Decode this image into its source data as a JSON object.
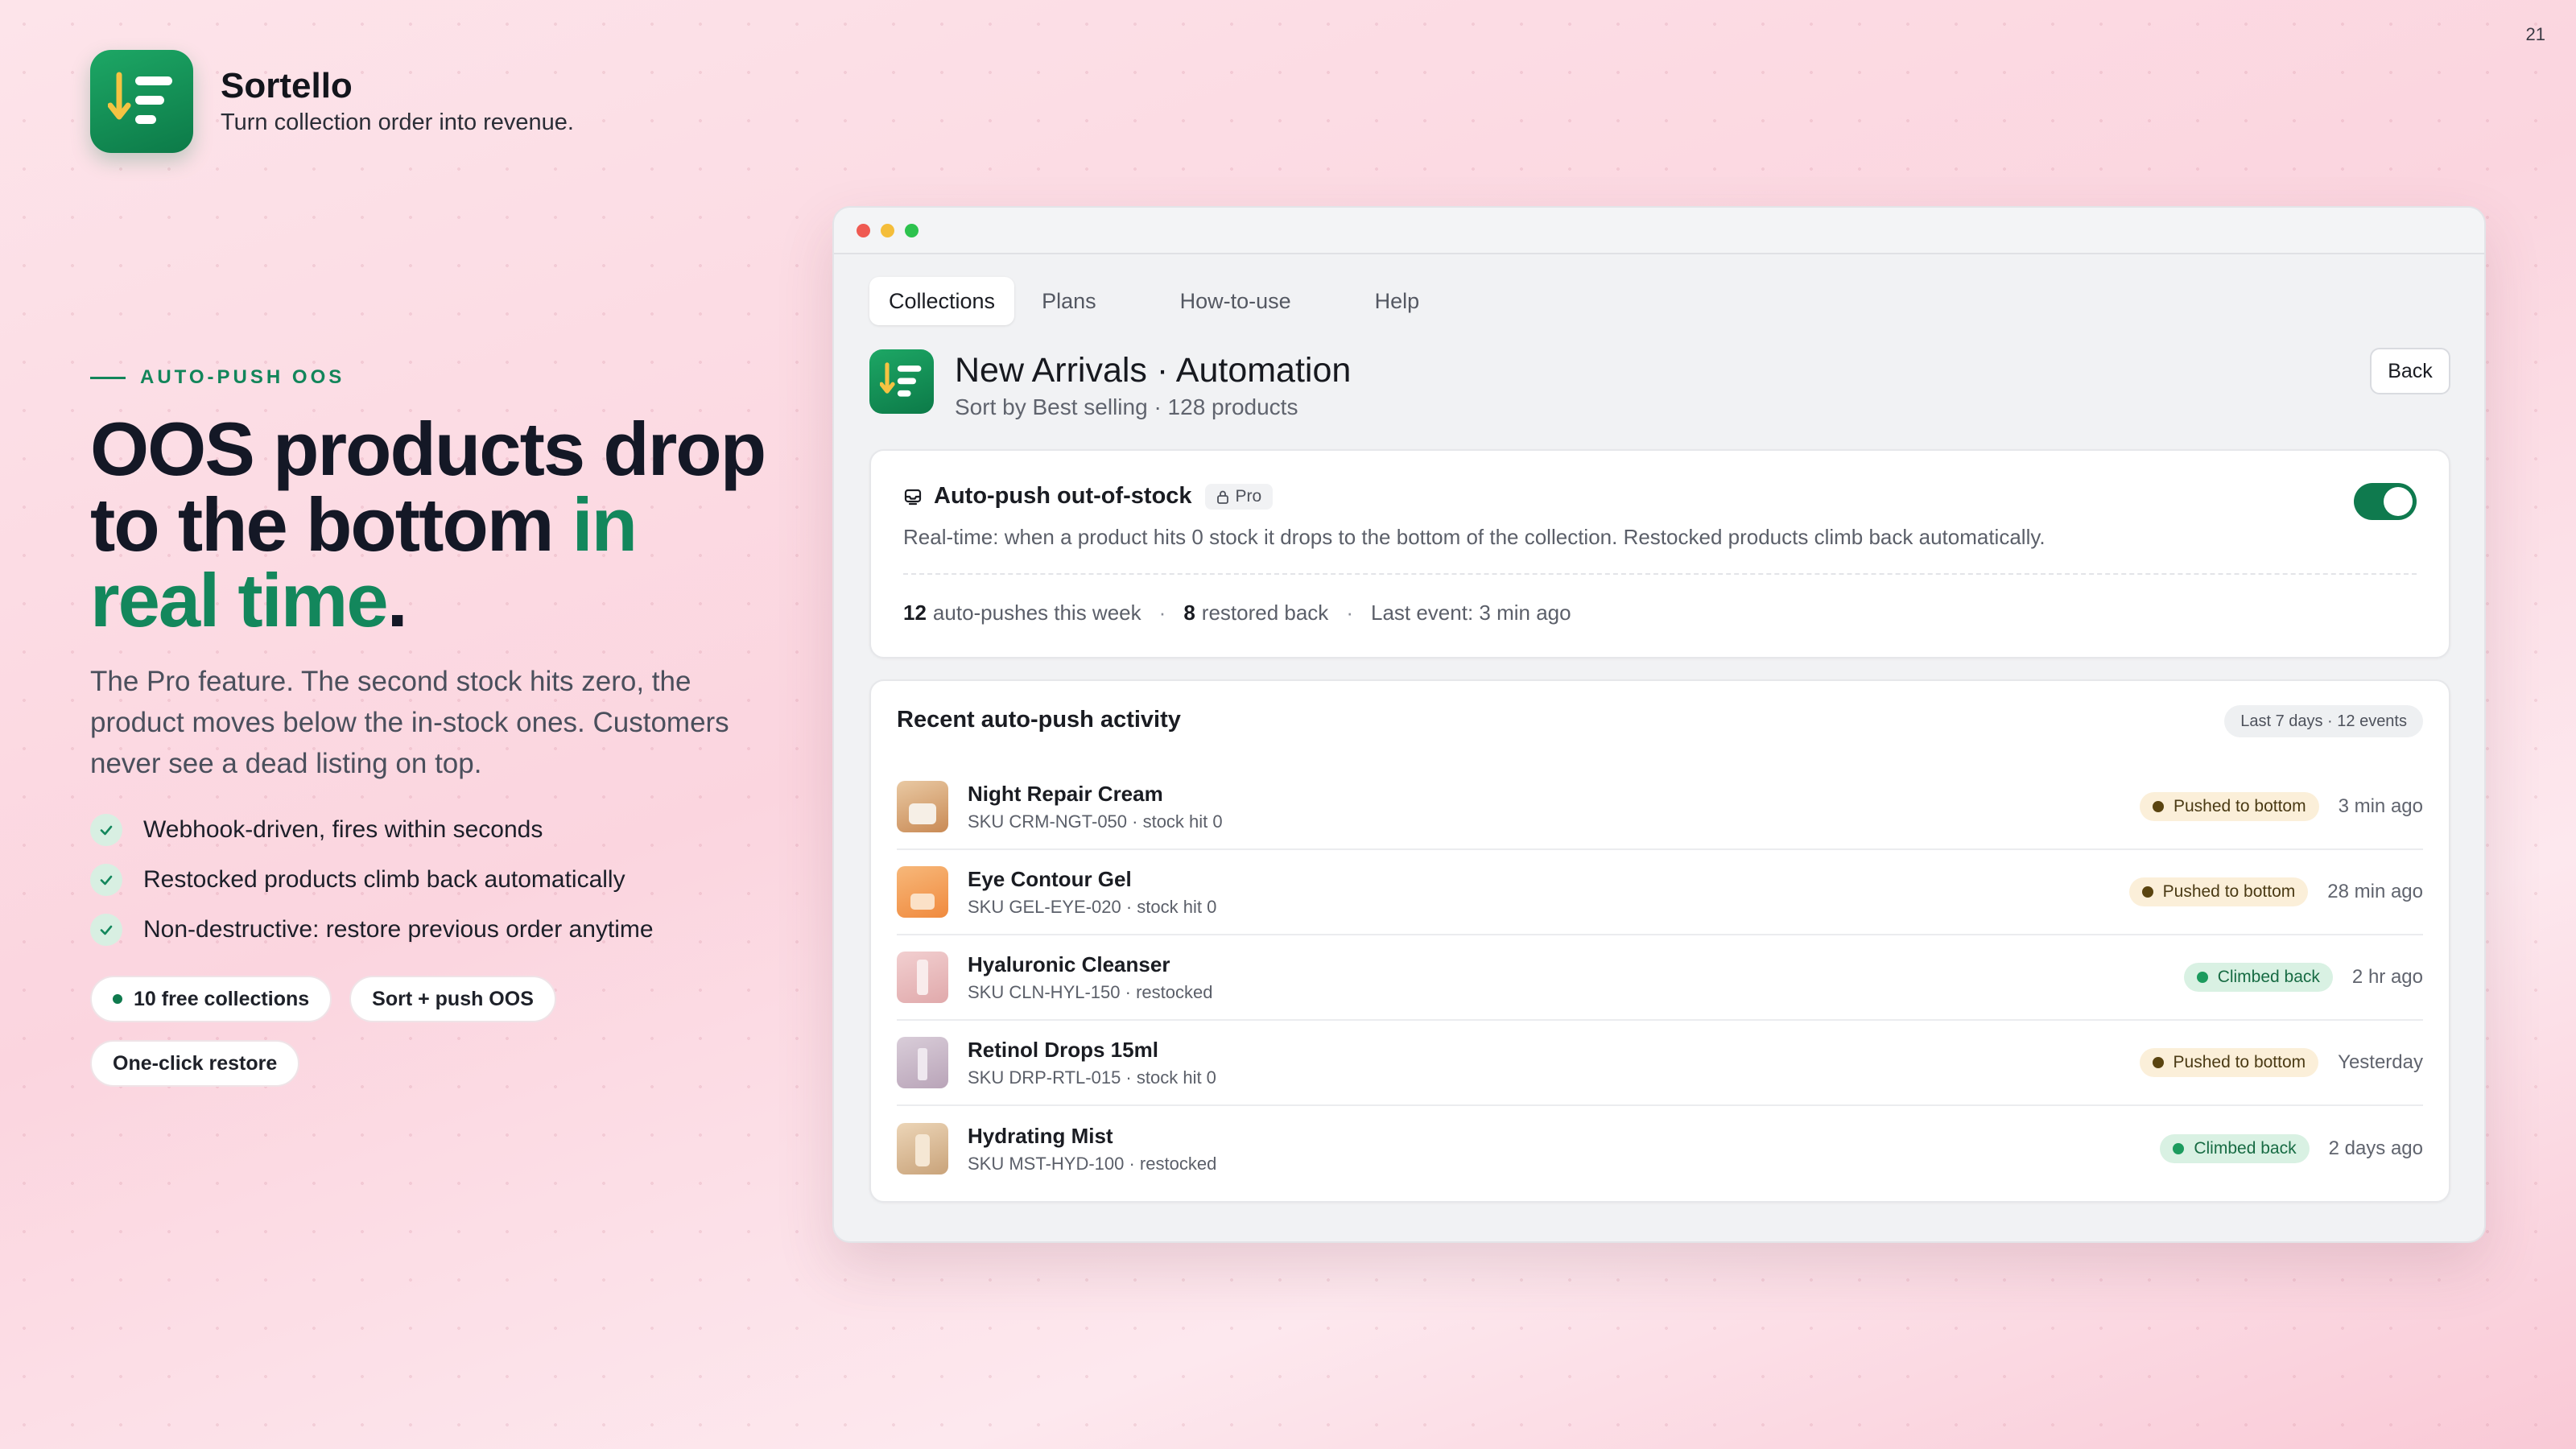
{
  "page_number": "21",
  "brand": {
    "name": "Sortello",
    "tagline": "Turn collection order into revenue."
  },
  "hero": {
    "eyebrow": "AUTO-PUSH OOS",
    "headline_part1": "OOS products drop to the bottom",
    "headline_accent": "in real time",
    "headline_end": ".",
    "lead": "The Pro feature. The second stock hits zero, the product moves below the in-stock ones. Customers never see a dead listing on top.",
    "features": [
      "Webhook-driven, fires within seconds",
      "Restocked products climb back automatically",
      "Non-destructive: restore previous order anytime"
    ],
    "pills": [
      "10 free collections",
      "Sort + push OOS",
      "One-click restore"
    ]
  },
  "app": {
    "tabs": [
      "Collections",
      "Plans",
      "How-to-use",
      "Help"
    ],
    "active_tab": "Collections",
    "page_title": "New Arrivals · Automation",
    "page_subtitle": "Sort by Best selling · 128 products",
    "back_label": "Back",
    "oos_card": {
      "title": "Auto-push out-of-stock",
      "badge": "Pro",
      "description": "Real-time: when a product hits 0 stock it drops to the bottom of the collection. Restocked products climb back automatically.",
      "toggle_on": true,
      "stat1_value": "12",
      "stat1_label": "auto-pushes this week",
      "stat2_value": "8",
      "stat2_label": "restored back",
      "stat3": "Last event: 3 min ago"
    },
    "activity": {
      "title": "Recent auto-push activity",
      "badge": "Last 7 days · 12 events",
      "rows": [
        {
          "name": "Night Repair Cream",
          "sku": "SKU CRM-NGT-050 · stock hit 0",
          "status": "Pushed to bottom",
          "status_type": "pushed",
          "time": "3 min ago"
        },
        {
          "name": "Eye Contour Gel",
          "sku": "SKU GEL-EYE-020 · stock hit 0",
          "status": "Pushed to bottom",
          "status_type": "pushed",
          "time": "28 min ago"
        },
        {
          "name": "Hyaluronic Cleanser",
          "sku": "SKU CLN-HYL-150 · restocked",
          "status": "Climbed back",
          "status_type": "climbed",
          "time": "2 hr ago"
        },
        {
          "name": "Retinol Drops 15ml",
          "sku": "SKU DRP-RTL-015 · stock hit 0",
          "status": "Pushed to bottom",
          "status_type": "pushed",
          "time": "Yesterday"
        },
        {
          "name": "Hydrating Mist",
          "sku": "SKU MST-HYD-100 · restocked",
          "status": "Climbed back",
          "status_type": "climbed",
          "time": "2 days ago"
        }
      ]
    }
  },
  "colors": {
    "brand_green": "#0f7a4e",
    "accent_text_green": "#13875c",
    "pushed_bg": "#fbefd9",
    "climbed_bg": "#d9f1e3"
  }
}
